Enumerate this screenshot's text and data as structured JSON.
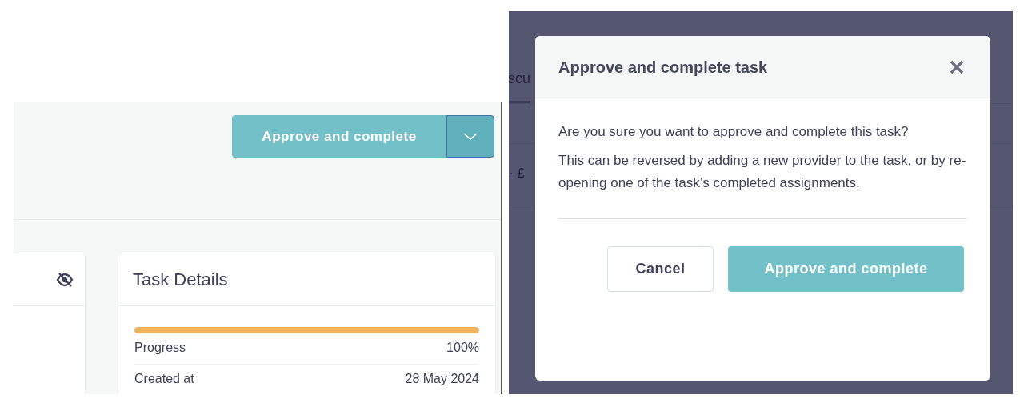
{
  "left_view": {
    "split_button": {
      "label": "Approve and complete"
    },
    "task_details": {
      "title": "Task Details",
      "progress": {
        "level": 1.0,
        "label": "Progress",
        "value": "100%"
      },
      "rows": [
        {
          "label": "Created at",
          "value": "28 May 2024"
        }
      ]
    }
  },
  "right_view": {
    "background": {
      "tab_label": "scu",
      "fragment": "· £"
    },
    "modal": {
      "title": "Approve and complete task",
      "paragraphs": [
        "Are you sure you want to approve and complete this task?",
        "This can be reversed by adding a new provider to the task, or by re-opening one of the task’s completed assignments."
      ],
      "buttons": [
        {
          "label": "Cancel",
          "kind": "secondary"
        },
        {
          "label": "Approve and complete",
          "kind": "primary"
        }
      ]
    }
  }
}
